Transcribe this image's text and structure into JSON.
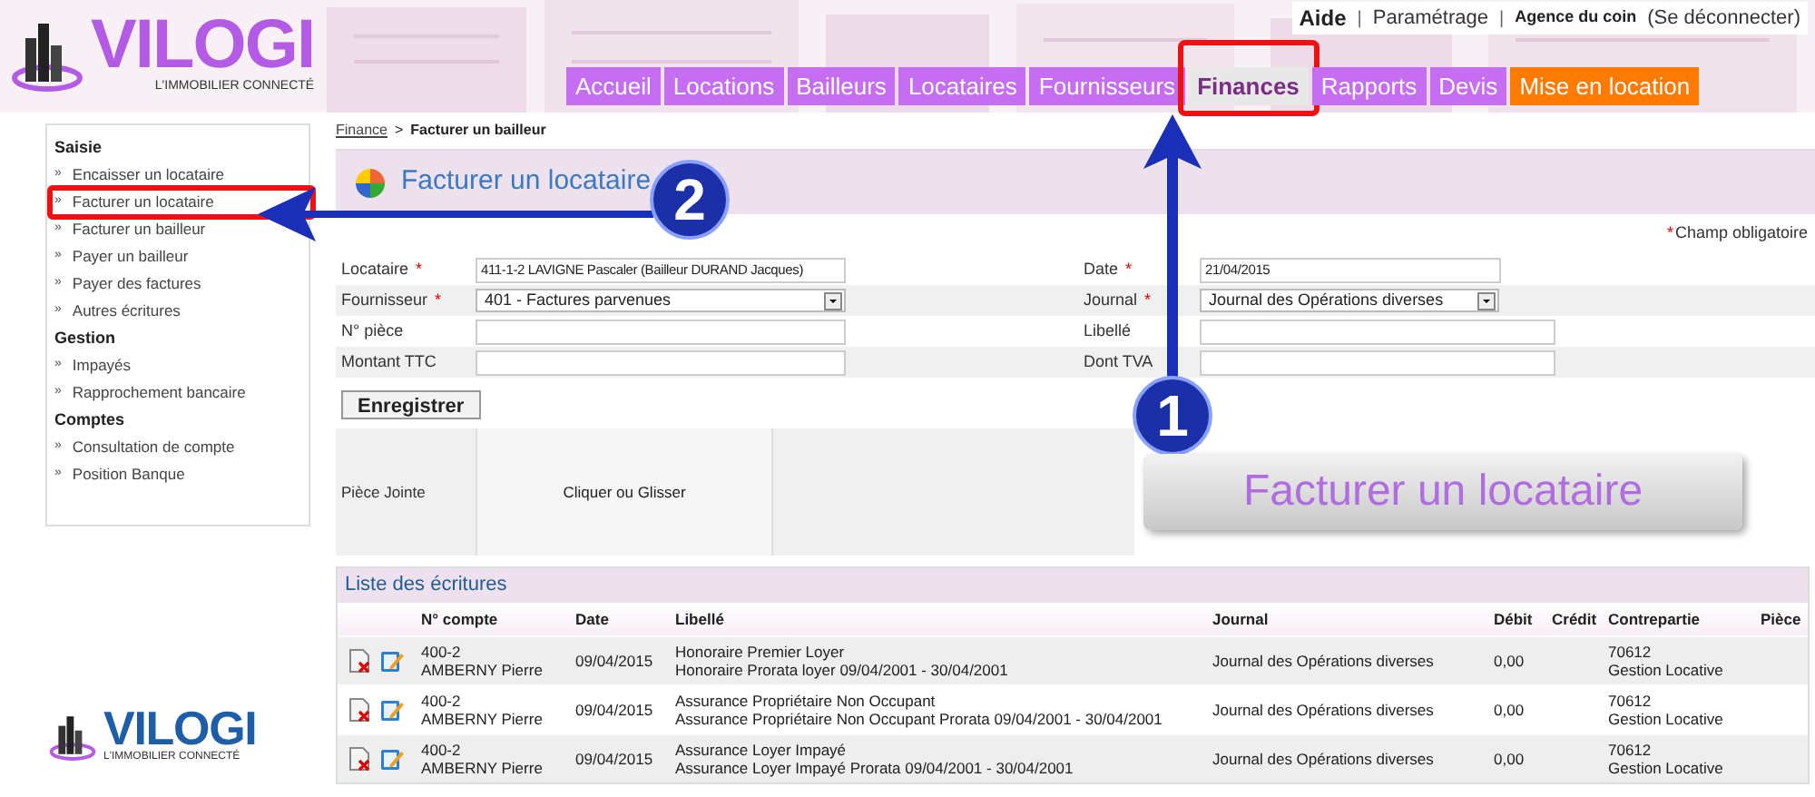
{
  "logo": {
    "name": "VILOGI",
    "tagline": "L'IMMOBILIER CONNECTÉ"
  },
  "top_links": [
    {
      "label": "Aide",
      "bold": true,
      "separator": "|"
    },
    {
      "label": "Paramétrage",
      "bold": false,
      "separator": "|"
    },
    {
      "label": "Agence du coin",
      "bold": true
    },
    {
      "label": "(Se déconnecter)",
      "bold": false
    }
  ],
  "nav": [
    {
      "label": "Accueil",
      "selected": false,
      "kind": "normal",
      "annotated": false
    },
    {
      "label": "Locations",
      "selected": false,
      "kind": "normal",
      "annotated": false
    },
    {
      "label": "Bailleurs",
      "selected": false,
      "kind": "normal",
      "annotated": false
    },
    {
      "label": "Locataires",
      "selected": false,
      "kind": "normal",
      "annotated": false
    },
    {
      "label": "Fournisseurs",
      "selected": false,
      "kind": "normal",
      "annotated": false
    },
    {
      "label": "Finances",
      "selected": true,
      "kind": "normal",
      "annotated": true
    },
    {
      "label": "Rapports",
      "selected": false,
      "kind": "normal",
      "annotated": false
    },
    {
      "label": "Devis",
      "selected": false,
      "kind": "normal",
      "annotated": false
    },
    {
      "label": "Mise en location",
      "selected": false,
      "kind": "highlight",
      "annotated": false
    }
  ],
  "sidebar": {
    "bullet": "»",
    "sections": [
      {
        "title": "Saisie",
        "items": [
          {
            "label": "Encaisser un locataire",
            "annotated": false
          },
          {
            "label": "Facturer un locataire",
            "annotated": true
          },
          {
            "label": "Facturer un bailleur",
            "annotated": false
          },
          {
            "label": "Payer un bailleur",
            "annotated": false
          },
          {
            "label": "Payer des factures",
            "annotated": false
          },
          {
            "label": "Autres écritures",
            "annotated": false
          }
        ]
      },
      {
        "title": "Gestion",
        "items": [
          {
            "label": "Impayés",
            "annotated": false
          },
          {
            "label": "Rapprochement bancaire",
            "annotated": false
          }
        ]
      },
      {
        "title": "Comptes",
        "items": [
          {
            "label": "Consultation de compte",
            "annotated": false
          },
          {
            "label": "Position Banque",
            "annotated": false
          }
        ]
      }
    ]
  },
  "footer_logo": {
    "name": "VILOGI",
    "tagline": "L'IMMOBILIER CONNECTÉ"
  },
  "breadcrumb": {
    "link": "Finance",
    "separator": ">",
    "current": "Facturer un bailleur"
  },
  "page_title": "Facturer un locataire",
  "required_note": {
    "mark": "*",
    "text": "Champ obligatoire"
  },
  "form_rows": [
    {
      "left": {
        "label": "Locataire",
        "required": true,
        "kind": "text",
        "value": "411-1-2 LAVIGNE Pascaler (Bailleur DURAND Jacques)"
      },
      "right": {
        "label": "Date",
        "required": true,
        "kind": "text",
        "value": "21/04/2015"
      }
    },
    {
      "left": {
        "label": "Fournisseur",
        "required": true,
        "kind": "select",
        "value": "401 - Factures parvenues"
      },
      "right": {
        "label": "Journal",
        "required": true,
        "kind": "select",
        "value": "Journal des Opérations diverses"
      }
    },
    {
      "left": {
        "label": "N° pièce",
        "required": false,
        "kind": "text"
      },
      "right": {
        "label": "Libellé",
        "required": false,
        "kind": "text"
      }
    },
    {
      "left": {
        "label": "Montant TTC",
        "required": false,
        "kind": "text"
      },
      "right": {
        "label": "Dont TVA",
        "required": false,
        "kind": "text"
      }
    }
  ],
  "save_button": "Enregistrer",
  "attachment": {
    "label": "Pièce Jointe",
    "dropzone": "Cliquer ou Glisser"
  },
  "table": {
    "title": "Liste des écritures",
    "columns": [
      "N° compte",
      "Date",
      "Libellé",
      "Journal",
      "Débit",
      "Crédit",
      "Contrepartie",
      "Pièce"
    ],
    "rows": [
      {
        "account": "400-2",
        "name": "AMBERNY Pierre",
        "date": "09/04/2015",
        "label1": "Honoraire Premier Loyer",
        "label2": "Honoraire Prorata loyer 09/04/2001 - 30/04/2001",
        "journal": "Journal des Opérations diverses",
        "debit": "0,00",
        "counterpart": "70612",
        "counterpart_name": "Gestion Locative"
      },
      {
        "account": "400-2",
        "name": "AMBERNY Pierre",
        "date": "09/04/2015",
        "label1": "Assurance Propriétaire Non Occupant",
        "label2": "Assurance Propriétaire Non Occupant Prorata 09/04/2001 - 30/04/2001",
        "journal": "Journal des Opérations diverses",
        "debit": "0,00",
        "counterpart": "70612",
        "counterpart_name": "Gestion Locative"
      },
      {
        "account": "400-2",
        "name": "AMBERNY Pierre",
        "date": "09/04/2015",
        "label1": "Assurance Loyer Impayé",
        "label2": "Assurance Loyer Impayé Prorata 09/04/2001 - 30/04/2001",
        "journal": "Journal des Opérations diverses",
        "debit": "0,00",
        "counterpart": "70612",
        "counterpart_name": "Gestion Locative"
      }
    ]
  },
  "annotations": {
    "steps": [
      "1",
      "2"
    ],
    "callout": "Facturer un locataire"
  }
}
